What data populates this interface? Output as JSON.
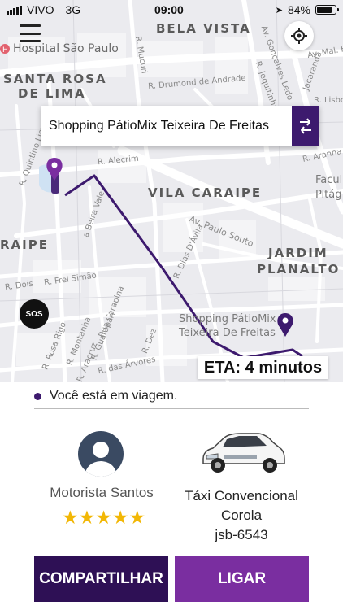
{
  "status_bar": {
    "carrier": "VIVO",
    "network": "3G",
    "time": "09:00",
    "battery_percent": "84%",
    "battery_level": 0.84
  },
  "map": {
    "areas": [
      "BELA VISTA",
      "SANTA ROSA",
      "DE LIMA",
      "VILA CARAIPE",
      "JARDIM",
      "PLANALTO",
      "RAIPE"
    ],
    "hospital": "Hospital São Paulo",
    "streets": [
      "R. Mucuri",
      "R. Drumond de Andrade",
      "Av. Gonçalves Ledo",
      "R. Jequitinhá",
      "R. Alecrim",
      "Av. Paulo Souto",
      "R. Dias D'Ávila",
      "R. Dois",
      "R. Frei Simão",
      "Rua Carapina",
      "R. Guarapari",
      "R. Montanha",
      "R. Rosa Rigo",
      "R. Araçruz",
      "R. das Árvores",
      "R. Dez",
      "R. Aranha",
      "R. Quintino Lima",
      "a Beira Vale",
      "Jacaranda",
      "R. Lisboa",
      "Av. Mal. Her"
    ],
    "poi_right": [
      "Facul",
      "Pitág"
    ],
    "destination_poi": [
      "Shopping PátioMix",
      "Teixeira De Freitas"
    ],
    "route_color": "#3d1a6e",
    "pin_color": "#7a2ea0"
  },
  "search": {
    "destination": "Shopping PátioMix Teixeira De Freitas"
  },
  "sos_label": "SOS",
  "eta_label": "ETA: 4 minutos",
  "trip": {
    "status": "Você está em viagem."
  },
  "driver": {
    "name": "Motorista Santos",
    "rating": 5,
    "rating_max": 5
  },
  "vehicle": {
    "type": "Táxi Convencional",
    "model": "Corola",
    "plate": "jsb-6543"
  },
  "actions": {
    "share_label": "COMPARTILHAR",
    "call_label": "LIGAR"
  },
  "colors": {
    "primary_dark": "#2e1055",
    "primary": "#7a2ea0",
    "star": "#f2b705"
  }
}
